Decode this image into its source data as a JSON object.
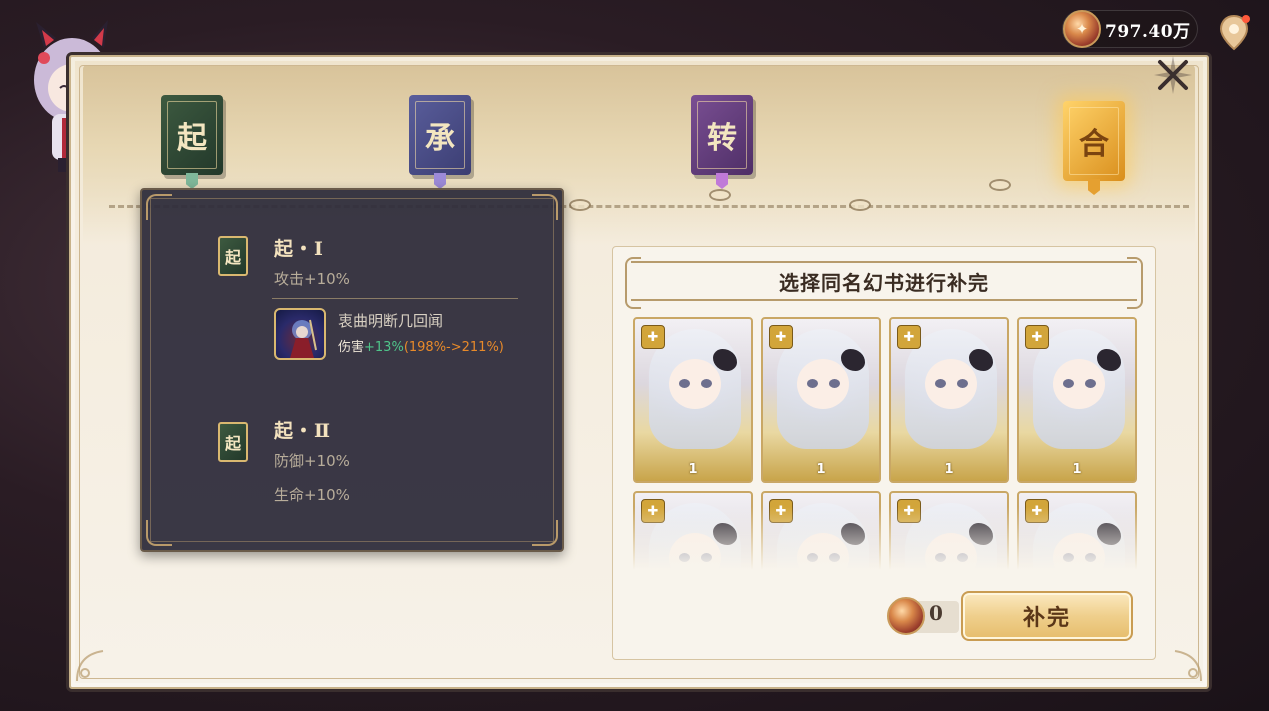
{
  "currency": {
    "value": "797.40万",
    "icon": "coin-icon"
  },
  "chapters": [
    {
      "label": "起",
      "color": "#2f4a36"
    },
    {
      "label": "承",
      "color": "#4a4d8a"
    },
    {
      "label": "转",
      "color": "#64407e"
    },
    {
      "label": "合",
      "color": "#f0b040"
    }
  ],
  "tooltip": {
    "stage1": {
      "book": "起",
      "title": "起・Ⅰ",
      "stat": "攻击+10%",
      "skill": {
        "name": "衷曲明断几回闻",
        "desc_prefix": "伤害",
        "desc_green": "+13%",
        "desc_orange": "(198%->211%)"
      }
    },
    "stage2": {
      "book": "起",
      "title": "起・Ⅱ",
      "stats": [
        "防御+10%",
        "生命+10%"
      ]
    }
  },
  "select": {
    "header": "选择同名幻书进行补完",
    "cards": [
      {
        "level": "1"
      },
      {
        "level": "1"
      },
      {
        "level": "1"
      },
      {
        "level": "1"
      },
      {
        "level": ""
      },
      {
        "level": ""
      },
      {
        "level": ""
      },
      {
        "level": ""
      }
    ],
    "cost": "0",
    "button": "补完"
  },
  "colors": {
    "accent_gold": "#e6bd6c",
    "tooltip_bg": "#2e2c3a",
    "green": "#4fc48a",
    "orange": "#e88a2a"
  }
}
